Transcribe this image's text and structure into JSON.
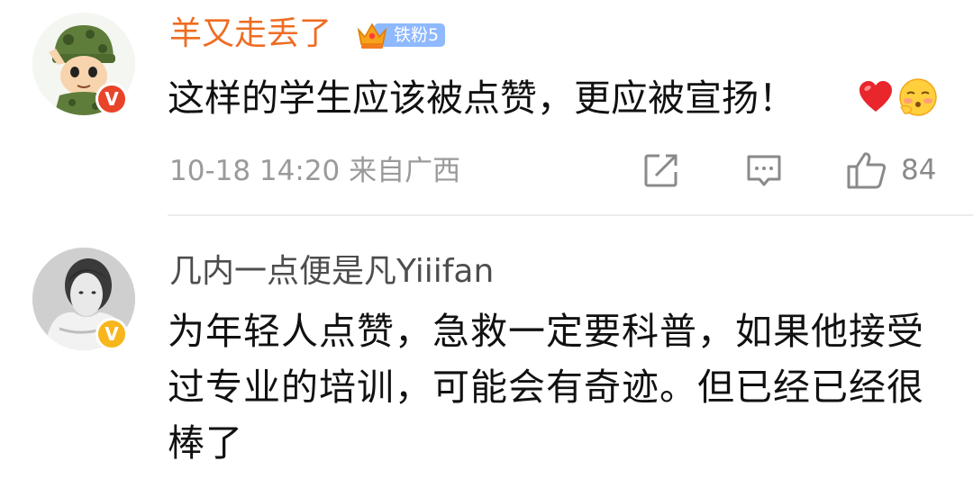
{
  "comments": [
    {
      "username": "羊又走丢了",
      "fan_badge": "铁粉5",
      "text": "这样的学生应该被点赞，更应被宣扬！",
      "emojis": [
        "heart-emoji",
        "blushing-face-emoji"
      ],
      "meta": "10-18 14:20  来自广西",
      "likes": "84",
      "verified_color": "#e8442a",
      "name_color": "#ee6c22"
    },
    {
      "username": "几内一点便是凡Yiiifan",
      "text": "为年轻人点赞，急救一定要科普，如果他接受过专业的培训，可能会有奇迹。但已经已经很棒了",
      "verified_color": "#f7b61c",
      "name_color": "#4d4d4d"
    }
  ]
}
